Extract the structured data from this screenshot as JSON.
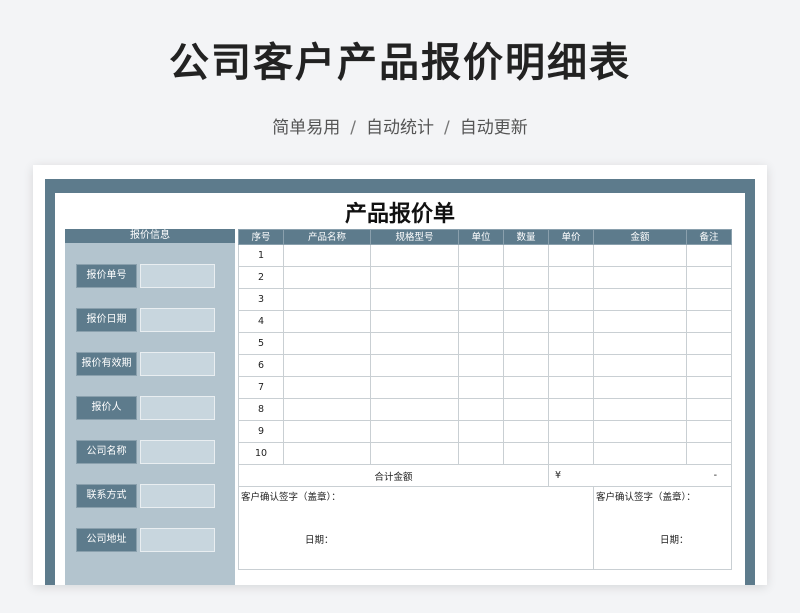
{
  "header": {
    "title": "公司客户产品报价明细表",
    "features": [
      "简单易用",
      "自动统计",
      "自动更新"
    ],
    "separator": "/"
  },
  "sheet": {
    "title": "产品报价单",
    "info": {
      "heading": "报价信息",
      "fields": [
        {
          "label": "报价单号",
          "value": ""
        },
        {
          "label": "报价日期",
          "value": ""
        },
        {
          "label": "报价有效期",
          "value": ""
        },
        {
          "label": "报价人",
          "value": ""
        },
        {
          "label": "公司名称",
          "value": ""
        },
        {
          "label": "联系方式",
          "value": ""
        },
        {
          "label": "公司地址",
          "value": ""
        }
      ]
    },
    "table": {
      "columns": [
        "序号",
        "产品名称",
        "规格型号",
        "单位",
        "数量",
        "单价",
        "金额",
        "备注"
      ],
      "rows": [
        {
          "no": "1"
        },
        {
          "no": "2"
        },
        {
          "no": "3"
        },
        {
          "no": "4"
        },
        {
          "no": "5"
        },
        {
          "no": "6"
        },
        {
          "no": "7"
        },
        {
          "no": "8"
        },
        {
          "no": "9"
        },
        {
          "no": "10"
        }
      ],
      "total_label": "合计金额",
      "currency": "¥",
      "total_value": "-",
      "sign_label": "客户确认签字（盖章）：",
      "date_label": "日期："
    }
  },
  "colors": {
    "accent": "#5d7b8c",
    "panel": "#b3c4ce",
    "input": "#c8d6de"
  }
}
